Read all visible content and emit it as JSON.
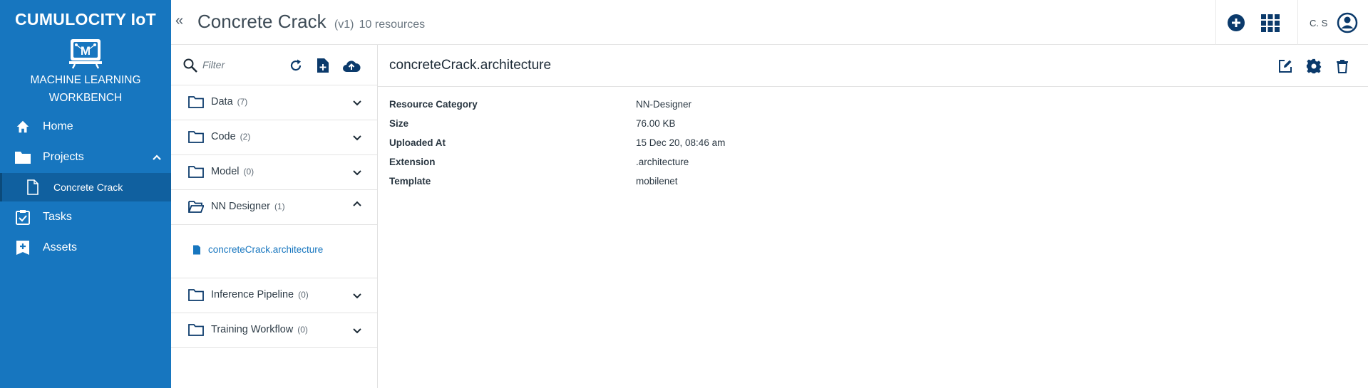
{
  "brand": "CUMULOCITY IoT",
  "app": {
    "name_line1": "MACHINE LEARNING",
    "name_line2": "WORKBENCH",
    "logo_icon": "ml-workbench-logo"
  },
  "sidebar": {
    "items": [
      {
        "label": "Home",
        "icon": "home-icon"
      },
      {
        "label": "Projects",
        "icon": "folder-icon",
        "expanded": true
      },
      {
        "label": "Tasks",
        "icon": "clipboard-check-icon"
      },
      {
        "label": "Assets",
        "icon": "plus-box-icon"
      }
    ],
    "sub_item": {
      "label": "Concrete Crack",
      "icon": "document-icon"
    }
  },
  "header": {
    "title": "Concrete Crack",
    "version": "(v1)",
    "resources": "10 resources",
    "user_initials": "C. S"
  },
  "panel": {
    "filter_placeholder": "Filter",
    "categories": [
      {
        "name": "Data",
        "count": "(7)",
        "expanded": false
      },
      {
        "name": "Code",
        "count": "(2)",
        "expanded": false
      },
      {
        "name": "Model",
        "count": "(0)",
        "expanded": false
      },
      {
        "name": "NN Designer",
        "count": "(1)",
        "expanded": true
      },
      {
        "name": "Inference Pipeline",
        "count": "(0)",
        "expanded": false
      },
      {
        "name": "Training Workflow",
        "count": "(0)",
        "expanded": false
      }
    ],
    "files": [
      {
        "name": "concreteCrack.architecture"
      }
    ]
  },
  "detail": {
    "title": "concreteCrack.architecture",
    "properties": [
      {
        "key": "Resource Category",
        "value": "NN-Designer"
      },
      {
        "key": "Size",
        "value": "76.00 KB"
      },
      {
        "key": "Uploaded At",
        "value": "15 Dec 20, 08:46 am"
      },
      {
        "key": "Extension",
        "value": ".architecture"
      },
      {
        "key": "Template",
        "value": "mobilenet"
      }
    ]
  },
  "colors": {
    "sidebar": "#1776bf",
    "sidebar_active": "#10609f",
    "accent": "#1776bf",
    "header_icons": "#0b3a6b"
  }
}
